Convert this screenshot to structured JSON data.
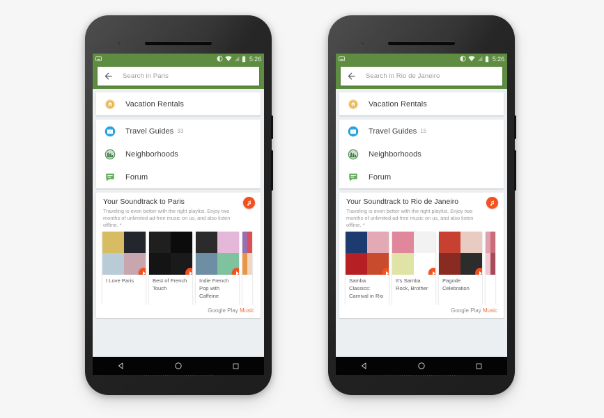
{
  "background_color": "#f6f6f6",
  "accent_green": "#5e8c40",
  "accent_orange": "#f4511e",
  "status_bar": {
    "time": "5:26",
    "icons": [
      "screenshot-icon",
      "dnd-icon",
      "wifi-icon",
      "signal-icon",
      "battery-icon"
    ]
  },
  "nav_bar": {
    "back_label": "Back",
    "home_label": "Home",
    "recents_label": "Recents"
  },
  "phones": [
    {
      "id": "paris",
      "search": {
        "placeholder": "Search in Paris",
        "value": "",
        "back_icon": "back-arrow-icon"
      },
      "rentals_card": {
        "label": "Vacation Rentals",
        "icon": "house-circle-icon",
        "count": ""
      },
      "list_card": [
        {
          "label": "Travel Guides",
          "count": "33",
          "icon": "book-icon"
        },
        {
          "label": "Neighborhoods",
          "count": "",
          "icon": "buildings-icon"
        },
        {
          "label": "Forum",
          "count": "",
          "icon": "chat-bubble-icon"
        }
      ],
      "music_card": {
        "title": "Your Soundtrack to Paris",
        "subtitle": "Traveling is even better with the right playlist. Enjoy two months of unlimited ad-free music on us, and also listen offline. *",
        "badge_icon": "music-note-icon",
        "footer_brand": "Google Play",
        "footer_brand_accent": "Music",
        "playlists": [
          {
            "name": "I Love Paris",
            "art_colors": [
              "#d8bc63",
              "#23262c",
              "#b9cbd6",
              "#c9a6ae"
            ]
          },
          {
            "name": "Best of French Touch",
            "art_colors": [
              "#1f1f1f",
              "#0c0c0c",
              "#141414",
              "#1a1a1a"
            ]
          },
          {
            "name": "Indie French Pop with Caffeine",
            "art_colors": [
              "#2b2b2b",
              "#e4b8d8",
              "#6e8ea3",
              "#7fc2a0"
            ]
          },
          {
            "name": "",
            "art_colors": [
              "#9a6fb0",
              "#d94f5c",
              "#e8954a",
              "#f0d6c0"
            ]
          }
        ]
      }
    },
    {
      "id": "rio",
      "search": {
        "placeholder": "Search in Rio de Janeiro",
        "value": "",
        "back_icon": "back-arrow-icon"
      },
      "rentals_card": {
        "label": "Vacation Rentals",
        "icon": "house-circle-icon",
        "count": ""
      },
      "list_card": [
        {
          "label": "Travel Guides",
          "count": "15",
          "icon": "book-icon"
        },
        {
          "label": "Neighborhoods",
          "count": "",
          "icon": "buildings-icon"
        },
        {
          "label": "Forum",
          "count": "",
          "icon": "chat-bubble-icon"
        }
      ],
      "music_card": {
        "title": "Your Soundtrack to Rio de Janeiro",
        "subtitle": "Traveling is even better with the right playlist. Enjoy two months of unlimited ad-free music on us, and also listen offline. *",
        "badge_icon": "music-note-icon",
        "footer_brand": "Google Play",
        "footer_brand_accent": "Music",
        "playlists": [
          {
            "name": "Samba Classics: Carnival in Rio",
            "art_colors": [
              "#1d3b6e",
              "#e3a9b4",
              "#b61f24",
              "#c84b2e"
            ]
          },
          {
            "name": "It's Samba Rock, Brother",
            "art_colors": [
              "#e0879b",
              "#f2f2f2",
              "#dfe3a6",
              "#ffffff"
            ]
          },
          {
            "name": "Pagode Celebration",
            "art_colors": [
              "#c8402f",
              "#e8ccc2",
              "#8a2b22",
              "#2c2c2c"
            ]
          },
          {
            "name": "",
            "art_colors": [
              "#e1a0ad",
              "#c86b7a",
              "#f0c9ce",
              "#a84a5b"
            ]
          }
        ]
      }
    }
  ]
}
